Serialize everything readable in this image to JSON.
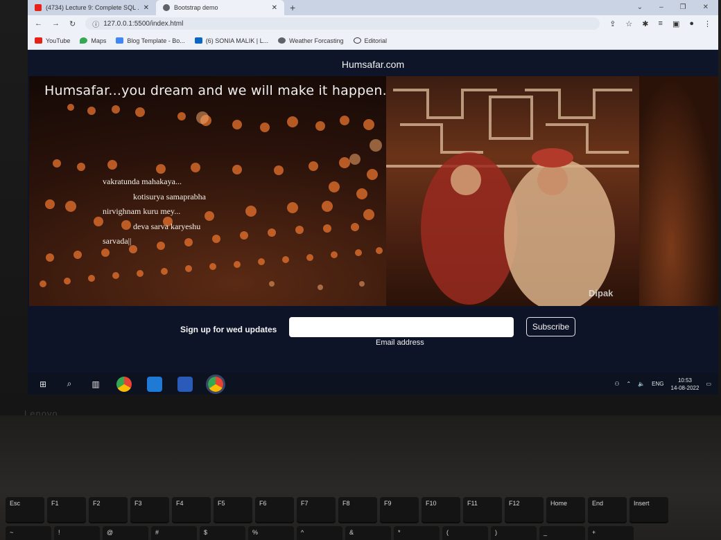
{
  "browser": {
    "tabs": [
      {
        "title": "(4734) Lecture 9: Complete SQL ...",
        "color": "#e62117"
      },
      {
        "title": "Bootstrap demo",
        "color": "#5f6368",
        "active": true
      }
    ],
    "new_tab": "+",
    "window_controls": [
      "⌄",
      "–",
      "❐",
      "✕"
    ],
    "url": "127.0.0.1:5500/index.html",
    "bookmarks": [
      {
        "label": "YouTube",
        "color": "#e62117"
      },
      {
        "label": "Maps",
        "color": "#34a853"
      },
      {
        "label": "Blog Template - Bo...",
        "color": "#4285f4"
      },
      {
        "label": "(6) SONIA MALIK | L...",
        "color": "#0a66c2"
      },
      {
        "label": "Weather Forcasting",
        "color": "#5f6368"
      },
      {
        "label": "Editorial",
        "color": "#333333"
      }
    ]
  },
  "site": {
    "brand": "Humsafar.com",
    "tagline": "Humsafar...you dream and we will make it happen.",
    "verse": [
      "vakratunda mahakaya...",
      "kotisurya samaprabha",
      "nirvighnam kuru mey...",
      "deva sarva karyeshu",
      "sarvada||"
    ],
    "photo_watermark": "Dipak",
    "signup": {
      "label": "Sign up for wed updates",
      "input_placeholder": "",
      "help_text": "Email address",
      "button": "Subscribe"
    }
  },
  "taskbar": {
    "language": "ENG",
    "time": "10:53",
    "date": "14-08-2022"
  },
  "keyboard": {
    "row1": [
      "Esc",
      "F1",
      "F2",
      "F3",
      "F4",
      "F5",
      "F6",
      "F7",
      "F8",
      "F9",
      "F10",
      "F11",
      "F12",
      "Home",
      "End",
      "Insert"
    ],
    "row2": [
      "~",
      "!",
      "@",
      "#",
      "$",
      "%",
      "^",
      "&",
      "*",
      "(",
      ")",
      "_",
      "+"
    ]
  },
  "laptop_brand": "Lenovo"
}
